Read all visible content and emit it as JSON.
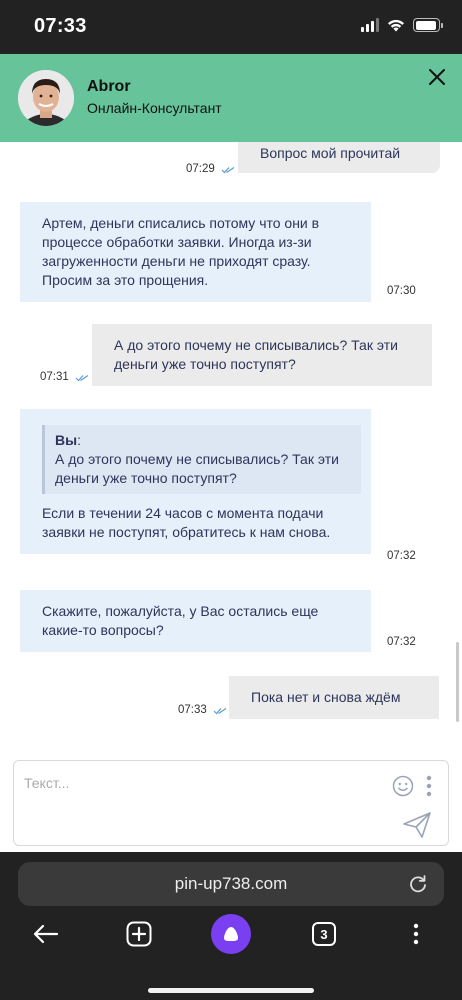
{
  "status_bar": {
    "time": "07:33",
    "battery_level": 0.95
  },
  "header": {
    "agent_name": "Abror",
    "agent_role": "Онлайн-Консультант",
    "accent_color": "#66c39a"
  },
  "messages": [
    {
      "direction": "out",
      "text": "Вопрос мой прочитай",
      "time": "07:29",
      "read": true
    },
    {
      "direction": "in",
      "text": "Артем, деньги списались потому что они в процессе обработки заявки. Иногда из-зи загруженности деньги не приходят сразу. Просим за это прощения.",
      "time": "07:30"
    },
    {
      "direction": "out",
      "text": "А до этого почему не списывались? Так эти деньги уже точно поступят?",
      "time": "07:31",
      "read": true
    },
    {
      "direction": "in",
      "quote_author": "Вы",
      "quote_text": "А до этого почему не списывались? Так эти деньги уже точно поступят?",
      "text": "Если в течении 24 часов с момента подачи заявки не поступят, обратитесь к нам снова.",
      "time": "07:32"
    },
    {
      "direction": "in",
      "text": "Скажите, пожалуйста, у Вас остались еще какие-то вопросы?",
      "time": "07:32"
    },
    {
      "direction": "out",
      "text": "Пока нет и снова ждём",
      "time": "07:33",
      "read": true
    }
  ],
  "composer": {
    "placeholder": "Текст...",
    "value": ""
  },
  "browser": {
    "url": "pin-up738.com",
    "tab_count": "3"
  },
  "icons": {
    "close": "close-icon",
    "emoji": "emoji-icon",
    "more": "more-vertical-icon",
    "send": "send-icon",
    "reload": "reload-icon",
    "back": "back-arrow-icon",
    "new_tab": "plus-icon",
    "alice": "alice-icon",
    "menu": "more-vertical-icon"
  },
  "colors": {
    "incoming_bubble": "#e6f0fb",
    "outgoing_bubble": "#ebebeb",
    "read_ticks": "#5a9bd5",
    "alice": "#7b3ff2"
  }
}
